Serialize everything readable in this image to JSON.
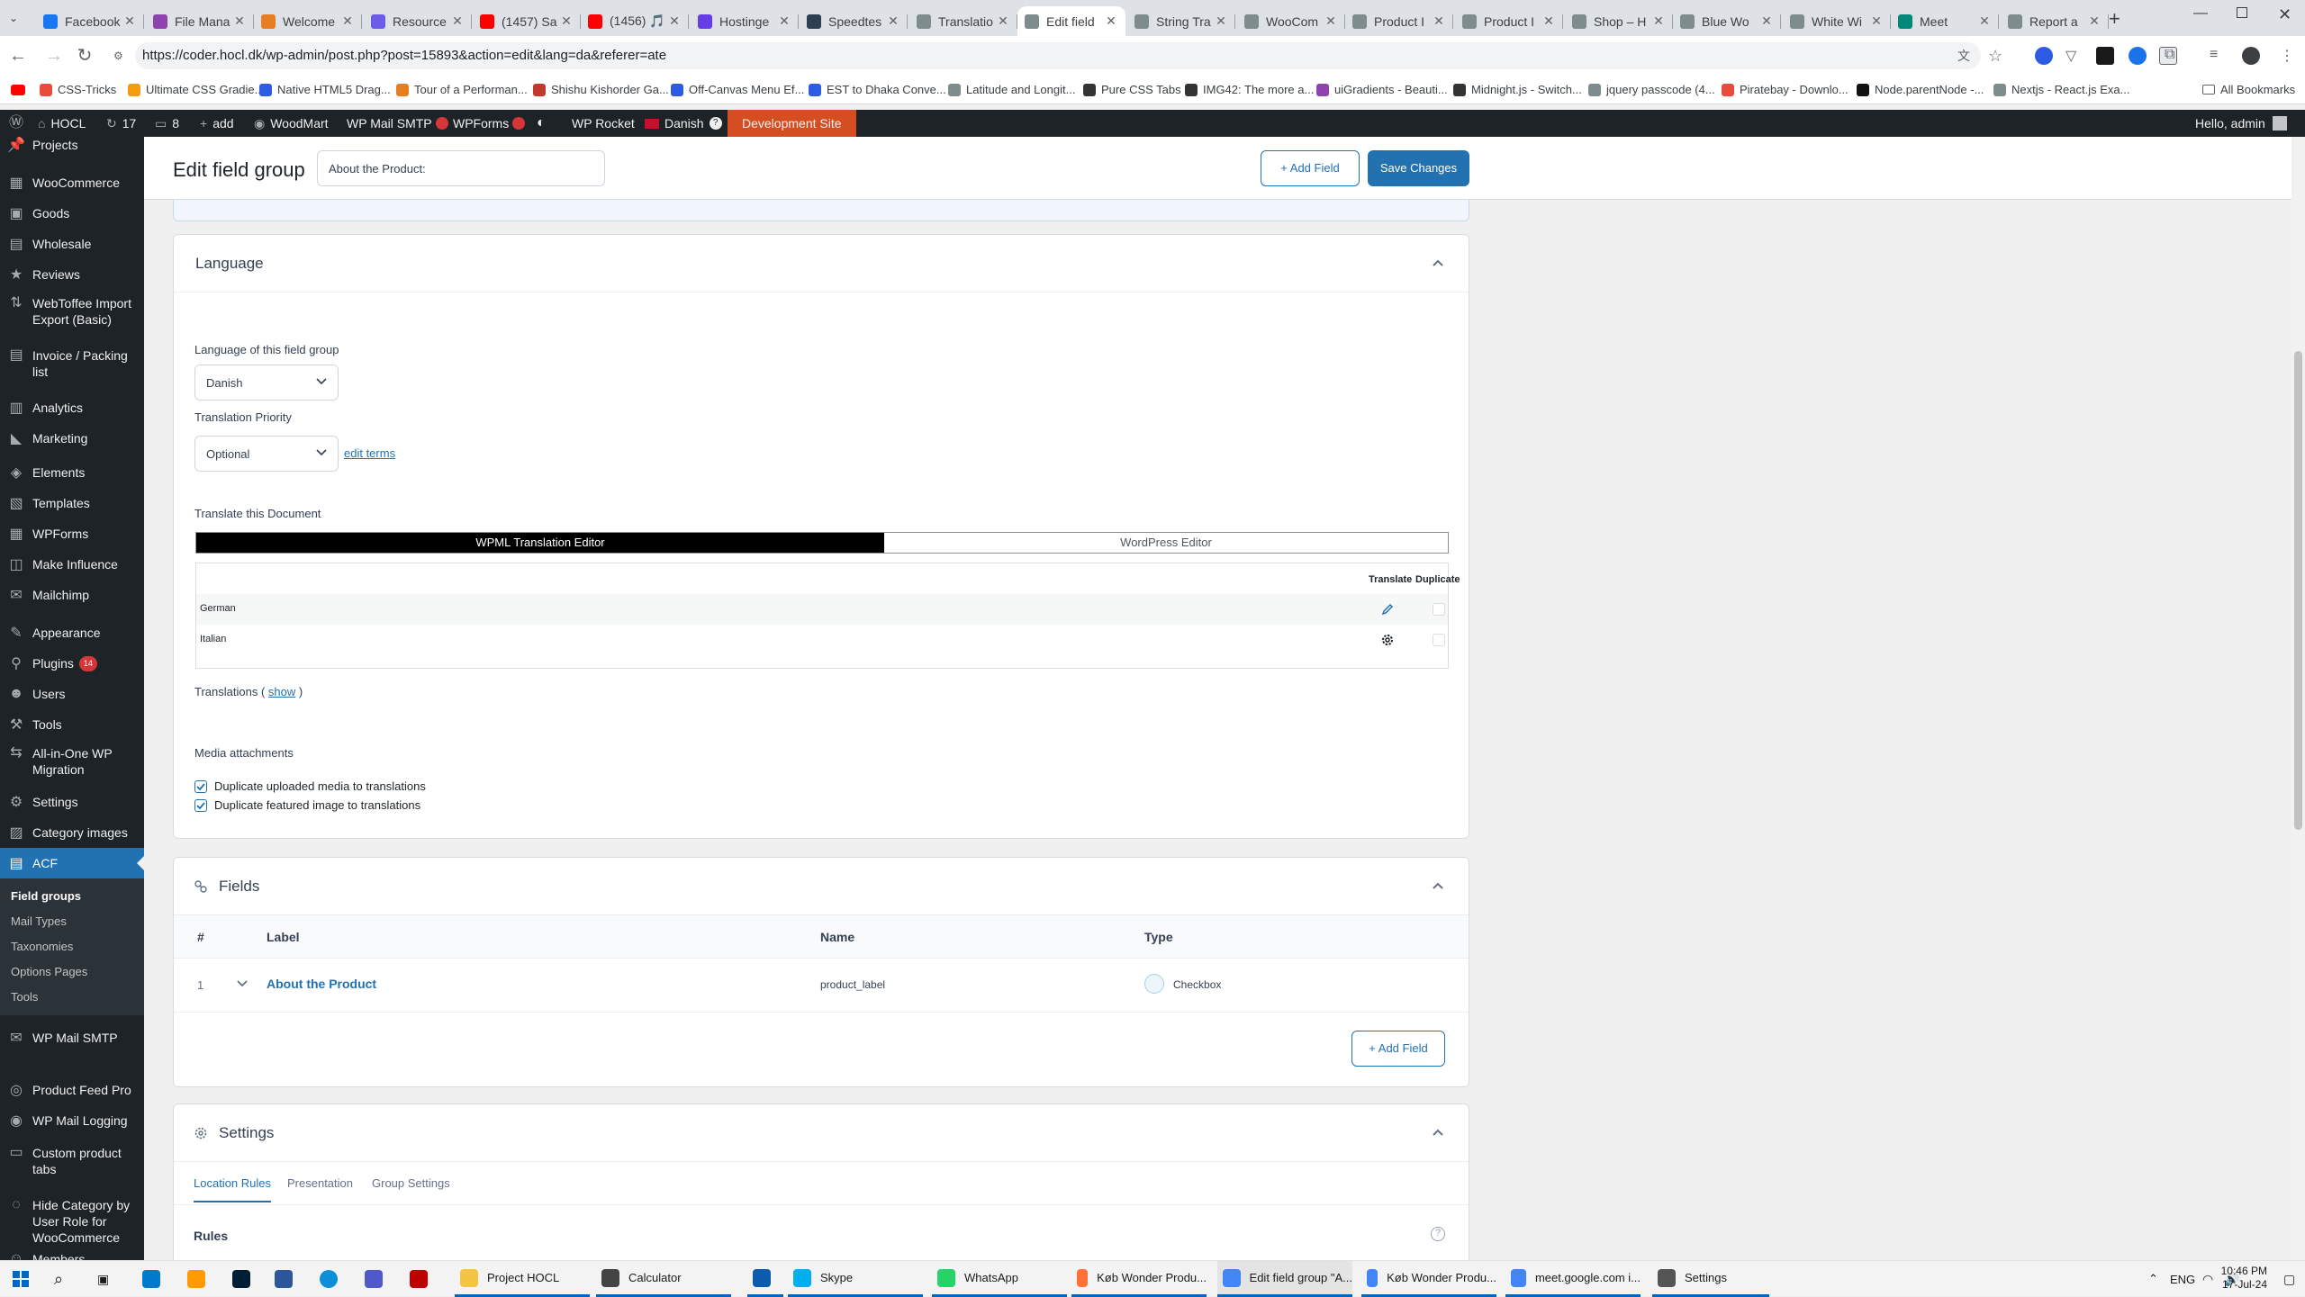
{
  "browser": {
    "tabs": [
      {
        "label": "Facebook",
        "color": "#1877f2"
      },
      {
        "label": "File Mana",
        "color": "#8e44ad"
      },
      {
        "label": "Welcome",
        "color": "#e67e22"
      },
      {
        "label": "Resource",
        "color": "#6c5ce7"
      },
      {
        "label": "(1457) Sa",
        "color": "#ff0000"
      },
      {
        "label": "(1456) 🎵",
        "color": "#ff0000"
      },
      {
        "label": "Hostinge",
        "color": "#673de6"
      },
      {
        "label": "Speedtes",
        "color": "#2c3e50"
      },
      {
        "label": "Translatio",
        "color": "#7f8c8d"
      },
      {
        "label": "Edit field",
        "color": "#7f8c8d",
        "active": true
      },
      {
        "label": "String Tra",
        "color": "#7f8c8d"
      },
      {
        "label": "WooCom",
        "color": "#7f8c8d"
      },
      {
        "label": "Product I",
        "color": "#7f8c8d"
      },
      {
        "label": "Product I",
        "color": "#7f8c8d"
      },
      {
        "label": "Shop – H",
        "color": "#7f8c8d"
      },
      {
        "label": "Blue Wo",
        "color": "#7f8c8d"
      },
      {
        "label": "White Wi",
        "color": "#7f8c8d"
      },
      {
        "label": "Meet",
        "color": "#00897b"
      },
      {
        "label": "Report a",
        "color": "#7f8c8d"
      }
    ],
    "url": "https://coder.hocl.dk/wp-admin/post.php?post=15893&action=edit&lang=da&referer=ate",
    "bookmarks": [
      {
        "label": "CSS-Tricks",
        "color": "#e74c3c"
      },
      {
        "label": "Ultimate CSS Gradie...",
        "color": "#f39c12"
      },
      {
        "label": "Native HTML5 Drag...",
        "color": "#2d5be3"
      },
      {
        "label": "Tour of a Performan...",
        "color": "#e67e22"
      },
      {
        "label": "Shishu Kishorder Ga...",
        "color": "#c0392b"
      },
      {
        "label": "Off-Canvas Menu Ef...",
        "color": "#2d5be3"
      },
      {
        "label": "EST to Dhaka Conve...",
        "color": "#2d5be3"
      },
      {
        "label": "Latitude and Longit...",
        "color": "#7f8c8d"
      },
      {
        "label": "Pure CSS Tabs",
        "color": "#333333"
      },
      {
        "label": "IMG42: The more a...",
        "color": "#333333"
      },
      {
        "label": "uiGradients - Beauti...",
        "color": "#8e44ad"
      },
      {
        "label": "Midnight.js - Switch...",
        "color": "#333333"
      },
      {
        "label": "jquery passcode (4...",
        "color": "#7f8c8d"
      },
      {
        "label": "Piratebay - Downlo...",
        "color": "#e74c3c"
      },
      {
        "label": "Node.parentNode -...",
        "color": "#111111"
      },
      {
        "label": "Nextjs - React.js Exa...",
        "color": "#7f8c8d"
      }
    ],
    "all_bookmarks": "All Bookmarks"
  },
  "adminbar": {
    "site": "HOCL",
    "updates": "17",
    "comments": "8",
    "add": "add",
    "woodmart": "WoodMart",
    "wpmail": "WP Mail SMTP",
    "wpforms": "WPForms",
    "wprocket": "WP Rocket",
    "language": "Danish",
    "devsite": "Development Site",
    "greeting": "Hello, admin"
  },
  "sidebar": {
    "items": [
      {
        "label": "Projects",
        "icon": "thumbtack-icon"
      },
      {
        "label": "WooCommerce",
        "icon": "woo-icon"
      },
      {
        "label": "Goods",
        "icon": "box-icon"
      },
      {
        "label": "Wholesale",
        "icon": "wholesale-icon"
      },
      {
        "label": "Reviews",
        "icon": "star-icon"
      },
      {
        "label": "WebToffee Import Export (Basic)",
        "icon": "import-icon"
      },
      {
        "label": "Invoice / Packing list",
        "icon": "invoice-icon"
      },
      {
        "label": "Analytics",
        "icon": "bar-chart-icon"
      },
      {
        "label": "Marketing",
        "icon": "megaphone-icon"
      },
      {
        "label": "Elements",
        "icon": "elements-icon"
      },
      {
        "label": "Templates",
        "icon": "templates-icon"
      },
      {
        "label": "WPForms",
        "icon": "wpforms-icon"
      },
      {
        "label": "Make Influence",
        "icon": "influence-icon"
      },
      {
        "label": "Mailchimp",
        "icon": "mailchimp-icon"
      },
      {
        "label": "Appearance",
        "icon": "brush-icon"
      },
      {
        "label": "Plugins",
        "icon": "plug-icon",
        "badge": "14"
      },
      {
        "label": "Users",
        "icon": "user-icon"
      },
      {
        "label": "Tools",
        "icon": "wrench-icon"
      },
      {
        "label": "All-in-One WP Migration",
        "icon": "migration-icon"
      },
      {
        "label": "Settings",
        "icon": "settings-icon"
      },
      {
        "label": "Category images",
        "icon": "image-icon"
      },
      {
        "label": "ACF",
        "icon": "acf-icon"
      }
    ],
    "acf_sub": [
      "Field groups",
      "Mail Types",
      "Taxonomies",
      "Options Pages",
      "Tools"
    ],
    "items2": [
      {
        "label": "WP Mail SMTP",
        "icon": "mail-icon"
      },
      {
        "label": "Product Feed Pro",
        "icon": "feed-icon"
      },
      {
        "label": "WP Mail Logging",
        "icon": "log-icon"
      },
      {
        "label": "Custom product tabs",
        "icon": "tabs-icon"
      },
      {
        "label": "Hide Category by User Role for WooCommerce",
        "icon": "hide-icon"
      },
      {
        "label": "Members",
        "icon": "members-icon"
      }
    ]
  },
  "header": {
    "title": "Edit field group",
    "group_name": "About the Product:",
    "add_field": "Add Field",
    "save": "Save Changes"
  },
  "language_panel": {
    "title": "Language",
    "lang_label": "Language of this field group",
    "lang_value": "Danish",
    "priority_label": "Translation Priority",
    "priority_value": "Optional",
    "edit_terms": "edit terms",
    "translate_doc": "Translate this Document",
    "editor_tabs": [
      "WPML Translation Editor",
      "WordPress Editor"
    ],
    "col_translate": "Translate",
    "col_duplicate": "Duplicate",
    "languages": [
      {
        "name": "German",
        "action": "pencil-icon"
      },
      {
        "name": "Italian",
        "action": "gear-icon"
      }
    ],
    "translations_label": "Translations (",
    "show": "show",
    "translations_close": ")",
    "media_title": "Media attachments",
    "media_opts": [
      {
        "label": "Duplicate uploaded media to translations",
        "checked": true
      },
      {
        "label": "Duplicate featured image to translations",
        "checked": true
      }
    ]
  },
  "fields_panel": {
    "title": "Fields",
    "cols": [
      "#",
      "Label",
      "Name",
      "Type"
    ],
    "rows": [
      {
        "num": "1",
        "label": "About the Product",
        "name": "product_label",
        "type": "Checkbox"
      }
    ],
    "add_field": "Add Field"
  },
  "settings_panel": {
    "title": "Settings",
    "tabs": [
      "Location Rules",
      "Presentation",
      "Group Settings"
    ],
    "rules": "Rules"
  },
  "taskbar": {
    "apps": [
      {
        "label": "Project HOCL",
        "color": "#f4c542"
      },
      {
        "label": "Calculator",
        "color": "#444444"
      },
      {
        "label": "",
        "color": "#0b5cad"
      },
      {
        "label": "Skype",
        "color": "#00aff0"
      },
      {
        "label": "WhatsApp",
        "color": "#25d366"
      },
      {
        "label": "Køb Wonder Produ...",
        "color": "#ff7139"
      },
      {
        "label": "Edit field group \"A...",
        "color": "#4285f4"
      },
      {
        "label": "Køb Wonder Produ...",
        "color": "#4285f4"
      },
      {
        "label": "meet.google.com i...",
        "color": "#4285f4"
      },
      {
        "label": "Settings",
        "color": "#555555"
      }
    ],
    "lang": "ENG",
    "time": "10:46 PM",
    "date": "17-Jul-24"
  }
}
